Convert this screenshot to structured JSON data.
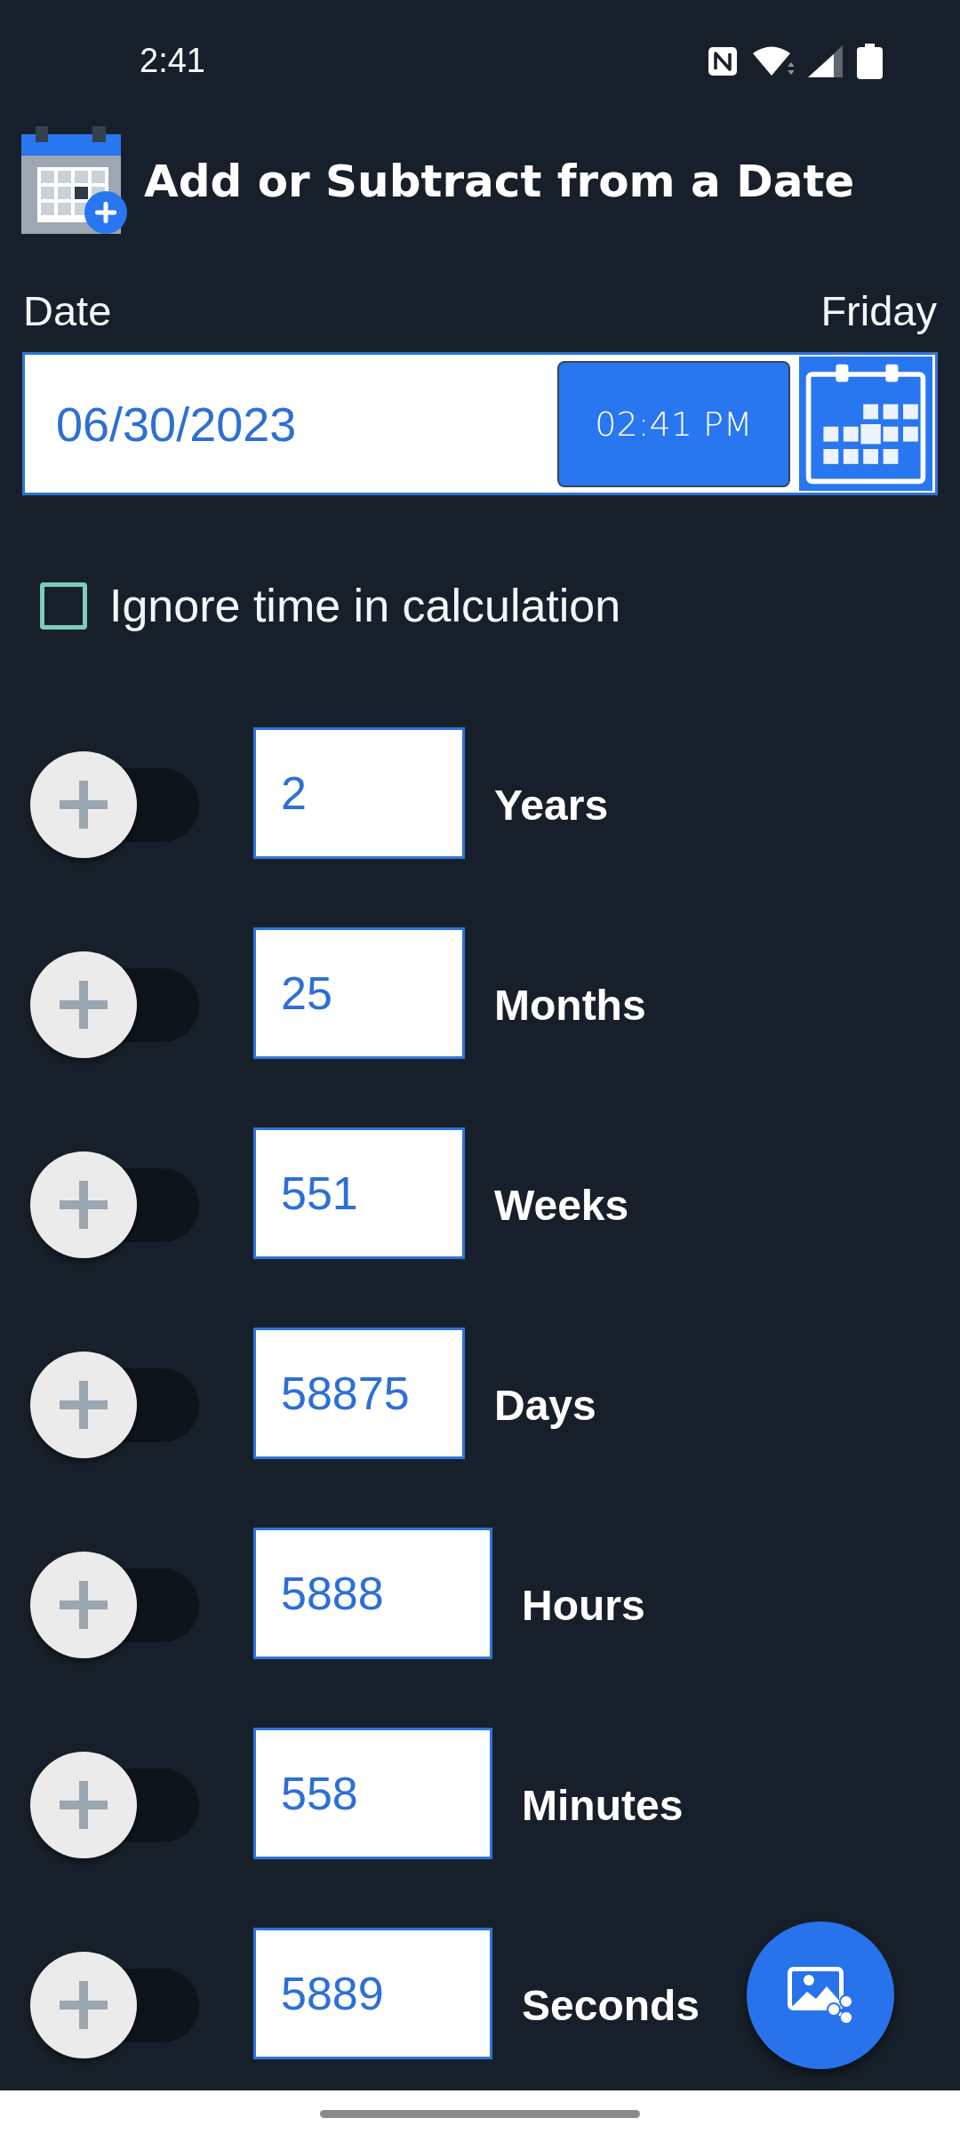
{
  "status_bar": {
    "time": "2:41"
  },
  "header": {
    "title": "Add or Subtract from a Date"
  },
  "date_section": {
    "label": "Date",
    "weekday": "Friday",
    "date_value": "06/30/2023",
    "time_button": "02:41 PM"
  },
  "ignore_time": {
    "label": "Ignore time in calculation",
    "checked": false
  },
  "units": [
    {
      "value": "2",
      "label": "Years",
      "on": false
    },
    {
      "value": "25",
      "label": "Months",
      "on": false
    },
    {
      "value": "551",
      "label": "Weeks",
      "on": false
    },
    {
      "value": "58875",
      "label": "Days",
      "on": false
    },
    {
      "value": "5888",
      "label": "Hours",
      "on": false
    },
    {
      "value": "558",
      "label": "Minutes",
      "on": false
    },
    {
      "value": "5889",
      "label": "Seconds",
      "on": false
    }
  ]
}
